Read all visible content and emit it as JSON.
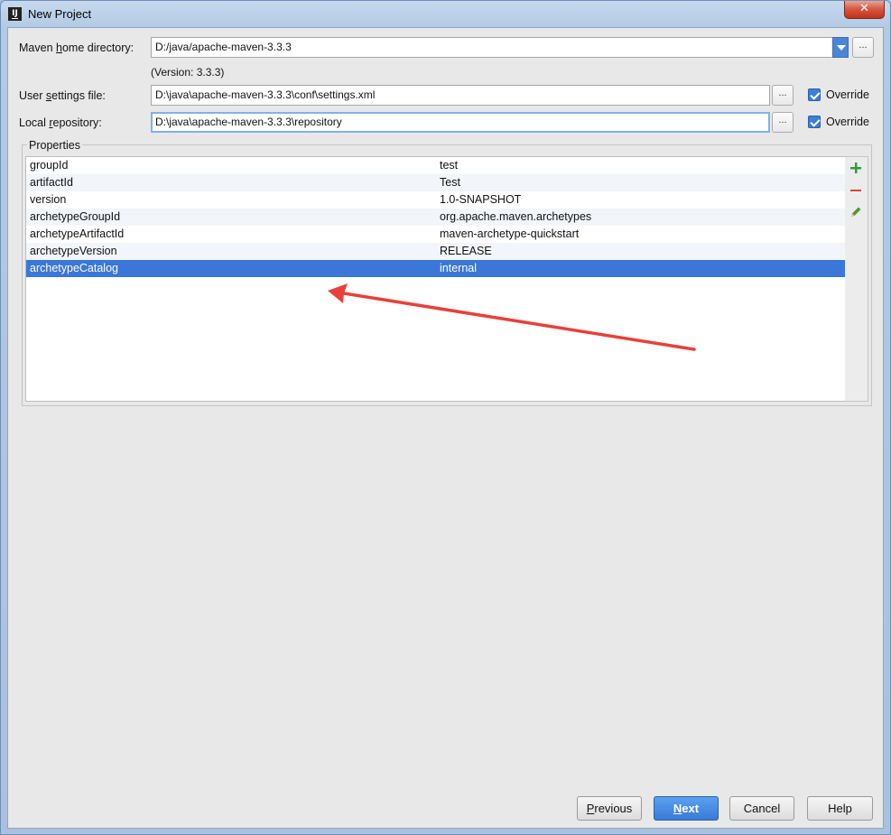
{
  "window": {
    "title": "New Project",
    "close_glyph": "✕"
  },
  "form": {
    "maven_home": {
      "label_pre": "Maven ",
      "label_u": "h",
      "label_post": "ome directory:",
      "value": "D:/java/apache-maven-3.3.3",
      "version_note": "(Version: 3.3.3)"
    },
    "user_settings": {
      "label_pre": "User ",
      "label_u": "s",
      "label_post": "ettings file:",
      "value": "D:\\java\\apache-maven-3.3.3\\conf\\settings.xml",
      "override_label": "Override",
      "override_checked": true
    },
    "local_repo": {
      "label_pre": "Local ",
      "label_u": "r",
      "label_post": "epository:",
      "value": "D:\\java\\apache-maven-3.3.3\\repository",
      "override_label": "Override",
      "override_checked": true
    },
    "browse_label": "..."
  },
  "properties": {
    "legend": "Properties",
    "rows": [
      {
        "key": "groupId",
        "value": "test"
      },
      {
        "key": "artifactId",
        "value": "Test"
      },
      {
        "key": "version",
        "value": "1.0-SNAPSHOT"
      },
      {
        "key": "archetypeGroupId",
        "value": "org.apache.maven.archetypes"
      },
      {
        "key": "archetypeArtifactId",
        "value": "maven-archetype-quickstart"
      },
      {
        "key": "archetypeVersion",
        "value": "RELEASE"
      },
      {
        "key": "archetypeCatalog",
        "value": "internal"
      }
    ],
    "selected_row": "archetypeCatalog",
    "tools": [
      {
        "icon": "add-icon",
        "color": "#2e9d3e"
      },
      {
        "icon": "remove-icon",
        "color": "#d9463a"
      },
      {
        "icon": "edit-icon",
        "color": "#4c9a2a"
      }
    ]
  },
  "annotation": {
    "arrow_color": "#e8403a"
  },
  "buttons": {
    "previous": {
      "pre": "",
      "u": "P",
      "post": "revious"
    },
    "next": {
      "pre": "",
      "u": "N",
      "post": "ext"
    },
    "cancel": "Cancel",
    "help": "Help"
  },
  "colors": {
    "accent": "#3a77d8",
    "client_bg": "#e8e8e8"
  }
}
